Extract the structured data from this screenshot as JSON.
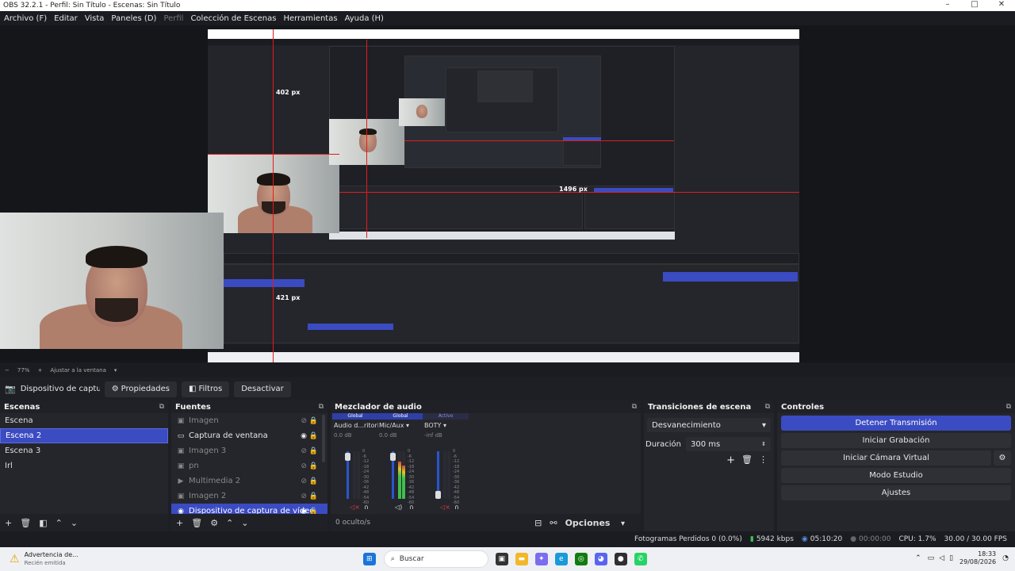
{
  "window": {
    "title": "OBS 32.2.1 - Perfil: Sin Título - Escenas: Sin Título",
    "controls": [
      "–",
      "□",
      "✕"
    ]
  },
  "menu": [
    {
      "label": "Archivo (F)",
      "enabled": true
    },
    {
      "label": "Editar",
      "enabled": true
    },
    {
      "label": "Vista",
      "enabled": true
    },
    {
      "label": "Paneles (D)",
      "enabled": true
    },
    {
      "label": "Perfil",
      "enabled": false
    },
    {
      "label": "Colección de Escenas",
      "enabled": true
    },
    {
      "label": "Herramientas",
      "enabled": true
    },
    {
      "label": "Ayuda (H)",
      "enabled": true
    }
  ],
  "preview": {
    "labels": [
      "402 px",
      "421 px",
      "1496 px"
    ]
  },
  "zoom": {
    "minus": "−",
    "value": "77%",
    "plus": "+",
    "fit": "Ajustar a la ventana"
  },
  "source_toolbar": {
    "selected_source": "Dispositivo de captura de v",
    "properties": "Propiedades",
    "filters": "Filtros",
    "deactivate": "Desactivar"
  },
  "scenes": {
    "title": "Escenas",
    "items": [
      "Escena",
      "Escena 2",
      "Escena 3",
      "Irl"
    ],
    "selected": 1
  },
  "sources": {
    "title": "Fuentes",
    "items": [
      {
        "label": "Imagen",
        "icon": "image-icon",
        "visible": false
      },
      {
        "label": "Captura de ventana",
        "icon": "window-icon",
        "visible": true
      },
      {
        "label": "Imagen 3",
        "icon": "image-icon",
        "visible": false
      },
      {
        "label": "pn",
        "icon": "image-icon",
        "visible": false
      },
      {
        "label": "Multimedia 2",
        "icon": "play-icon",
        "visible": false
      },
      {
        "label": "Imagen 2",
        "icon": "image-icon",
        "visible": false
      },
      {
        "label": "Dispositivo de captura de vídeo",
        "icon": "camera-icon",
        "visible": true
      }
    ],
    "selected": 6
  },
  "mixer": {
    "title": "Mezclador de audio",
    "channels": [
      {
        "tag": "Global",
        "name": "Audio d...ritorio",
        "db": "0.0 dB",
        "active": false,
        "muted": true
      },
      {
        "tag": "Global",
        "name": "Mic/Aux",
        "db": "0.0 dB",
        "active": true,
        "muted": false
      },
      {
        "tag": "Activo",
        "name": "BOTY",
        "db": "-inf dB",
        "active": false,
        "muted": true
      }
    ],
    "scale": [
      "0",
      "-6",
      "-12",
      "-18",
      "-24",
      "-30",
      "-36",
      "-42",
      "-48",
      "-54",
      "-60"
    ],
    "hidden": "0 oculto/s",
    "options": "Opciones"
  },
  "transitions": {
    "title": "Transiciones de escena",
    "type": "Desvanecimiento",
    "duration_label": "Duración",
    "duration_value": "300 ms"
  },
  "controls": {
    "title": "Controles",
    "buttons": [
      "Detener Transmisión",
      "Iniciar Grabación",
      "Iniciar Cámara Virtual",
      "Modo Estudio",
      "Ajustes"
    ]
  },
  "status": {
    "dropped": "Fotogramas Perdidos 0 (0.0%)",
    "bitrate": "5942 kbps",
    "stream_time": "05:10:20",
    "rec_time": "00:00:00",
    "cpu": "CPU: 1.7%",
    "fps": "30.00 / 30.00 FPS"
  },
  "taskbar": {
    "notification_title": "Advertencia de...",
    "notification_sub": "Recién emitida",
    "search": "Buscar",
    "time": "18:33",
    "date": "29/08/2026"
  },
  "colors": {
    "accent": "#3b4bc2",
    "live_red": "#e21b1b"
  }
}
